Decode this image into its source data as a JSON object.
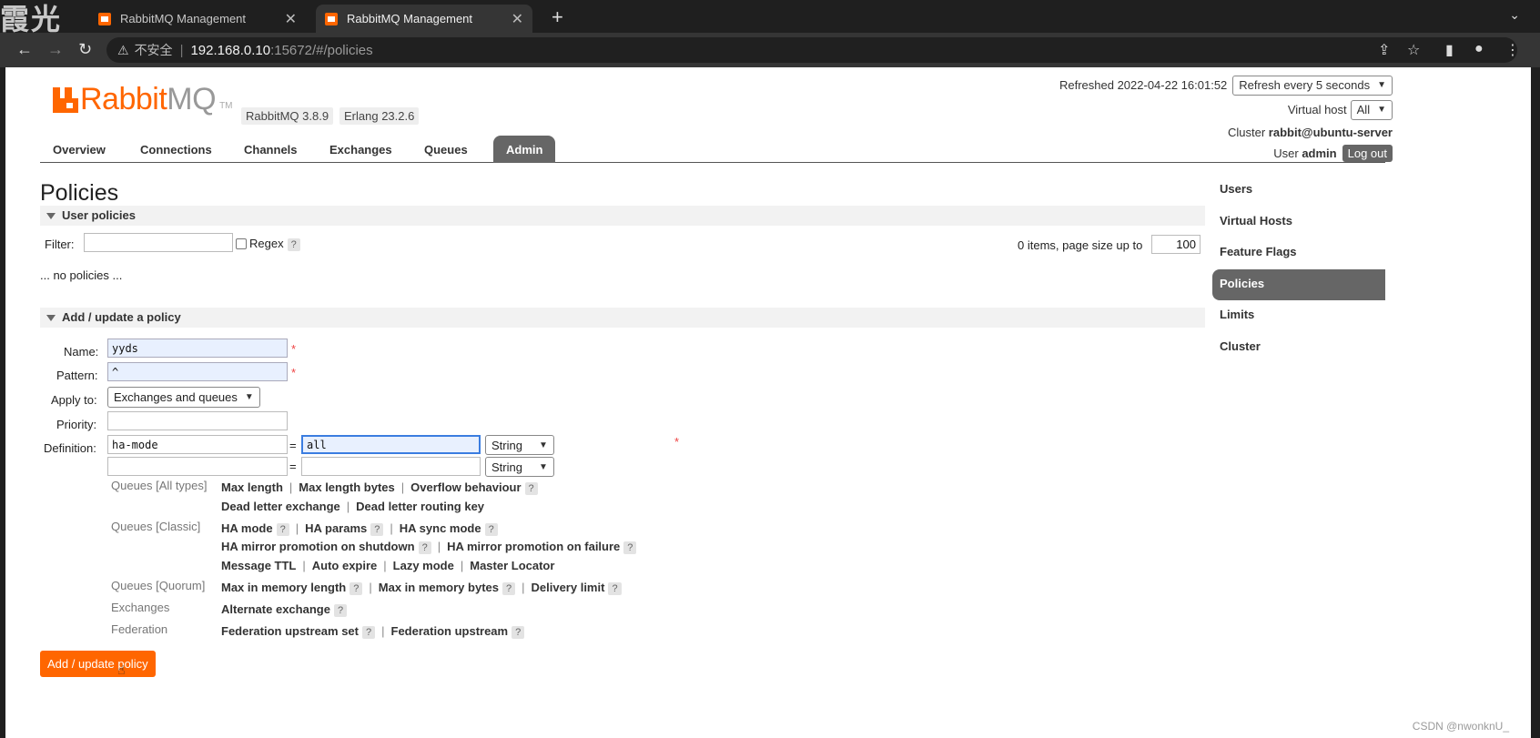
{
  "browser": {
    "watermark": "霞光",
    "tabs": [
      {
        "title": "RabbitMQ Management",
        "active": false
      },
      {
        "title": "RabbitMQ Management",
        "active": true
      }
    ],
    "url": {
      "security": "不安全",
      "host": "192.168.0.10",
      "path": ":15672/#/policies"
    }
  },
  "header": {
    "logo_r": "Rabbit",
    "logo_m": "MQ",
    "logo_tm": "TM",
    "version": "RabbitMQ 3.8.9",
    "erlang": "Erlang 23.2.6",
    "refreshed_label": "Refreshed 2022-04-22 16:01:52",
    "refresh_select": "Refresh every 5 seconds",
    "vhost_label": "Virtual host",
    "vhost_select": "All",
    "cluster_label": "Cluster",
    "cluster_name": "rabbit@ubuntu-server",
    "user_label": "User",
    "user_name": "admin",
    "logout": "Log out"
  },
  "menu": [
    "Overview",
    "Connections",
    "Channels",
    "Exchanges",
    "Queues",
    "Admin"
  ],
  "page_title": "Policies",
  "user_policies": {
    "title": "User policies",
    "filter_label": "Filter:",
    "filter_value": "",
    "regex_label": "Regex",
    "help": "?",
    "items_label": "0 items, page size up to",
    "page_size": "100",
    "empty_msg": "... no policies ..."
  },
  "add_policy": {
    "title": "Add / update a policy",
    "name_label": "Name:",
    "name_value": "yyds",
    "pattern_label": "Pattern:",
    "pattern_value": "^",
    "apply_label": "Apply to:",
    "apply_value": "Exchanges and queues",
    "priority_label": "Priority:",
    "priority_value": "",
    "definition_label": "Definition:",
    "def_rows": [
      {
        "key": "ha-mode",
        "value": "all",
        "type": "String"
      },
      {
        "key": "",
        "value": "",
        "type": "String"
      }
    ],
    "equals": "=",
    "required": "*",
    "help_categories": [
      {
        "label": "Queues [All types]",
        "lines": [
          [
            "Max length",
            "Max length bytes",
            "Overflow behaviour ?"
          ],
          [
            "Dead letter exchange",
            "Dead letter routing key"
          ]
        ]
      },
      {
        "label": "Queues [Classic]",
        "lines": [
          [
            "HA mode ?",
            "HA params ?",
            "HA sync mode ?"
          ],
          [
            "HA mirror promotion on shutdown ?",
            "HA mirror promotion on failure ?"
          ],
          [
            "Message TTL",
            "Auto expire",
            "Lazy mode",
            "Master Locator"
          ]
        ]
      },
      {
        "label": "Queues [Quorum]",
        "lines": [
          [
            "Max in memory length ?",
            "Max in memory bytes ?",
            "Delivery limit ?"
          ]
        ]
      },
      {
        "label": "Exchanges",
        "lines": [
          [
            "Alternate exchange ?"
          ]
        ]
      },
      {
        "label": "Federation",
        "lines": [
          [
            "Federation upstream set ?",
            "Federation upstream ?"
          ]
        ]
      }
    ],
    "submit": "Add / update policy"
  },
  "sidebar": [
    "Users",
    "Virtual Hosts",
    "Feature Flags",
    "Policies",
    "Limits",
    "Cluster"
  ],
  "sidebar_active": "Policies",
  "footer_watermark": "CSDN @nwonknU_",
  "colors": {
    "accent": "#ff6600",
    "active_tab": "#666666"
  }
}
